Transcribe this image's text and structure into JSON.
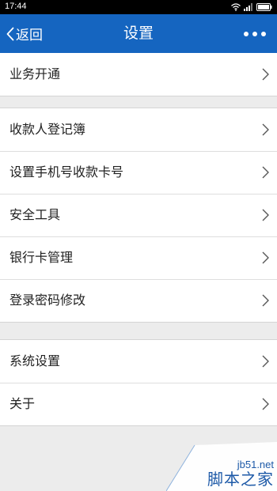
{
  "status_bar": {
    "time": "17:44"
  },
  "nav_bar": {
    "back_label": "返回",
    "title": "设置",
    "background_color": "#1565c0"
  },
  "groups": [
    {
      "items": [
        {
          "label": "业务开通",
          "icon": "chevron-right-icon"
        }
      ]
    },
    {
      "items": [
        {
          "label": "收款人登记簿",
          "icon": "chevron-right-icon"
        },
        {
          "label": "设置手机号收款卡号",
          "icon": "chevron-right-icon"
        },
        {
          "label": "安全工具",
          "icon": "chevron-right-icon"
        },
        {
          "label": "银行卡管理",
          "icon": "chevron-right-icon"
        },
        {
          "label": "登录密码修改",
          "icon": "chevron-right-icon"
        }
      ]
    },
    {
      "items": [
        {
          "label": "系统设置",
          "icon": "chevron-right-icon"
        },
        {
          "label": "关于",
          "icon": "chevron-right-icon"
        }
      ]
    }
  ],
  "watermark": {
    "url": "jb51.net",
    "text": "脚本之家"
  }
}
